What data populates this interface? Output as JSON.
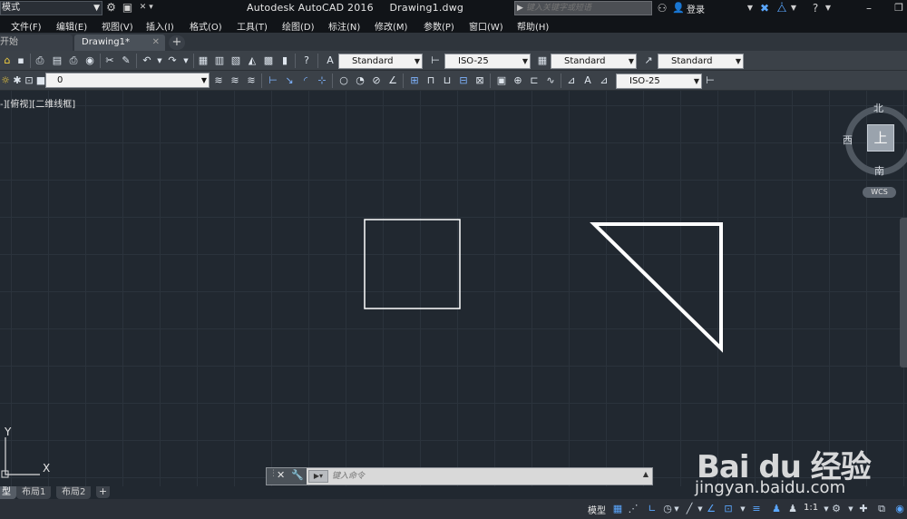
{
  "title_bar": {
    "workspace": "模式",
    "app_name": "Autodesk AutoCAD 2016",
    "file_name": "Drawing1.dwg",
    "search_placeholder": "键入关键字或短语",
    "login_label": "登录"
  },
  "menu": {
    "items": [
      "文件(F)",
      "编辑(E)",
      "视图(V)",
      "插入(I)",
      "格式(O)",
      "工具(T)",
      "绘图(D)",
      "标注(N)",
      "修改(M)",
      "参数(P)",
      "窗口(W)",
      "帮助(H)"
    ]
  },
  "tabs": {
    "items": [
      {
        "label": "开始"
      },
      {
        "label": "Drawing1*"
      }
    ],
    "add_label": "+"
  },
  "toolbar": {
    "text_style": "Standard",
    "dim_style": "ISO-25",
    "table_style": "Standard",
    "multileader_style": "Standard",
    "layer": "0",
    "dim_style_2": "ISO-25"
  },
  "viewport": {
    "label": "-][俯视][二维线框]"
  },
  "viewcube": {
    "north": "北",
    "south": "南",
    "west": "西",
    "face": "上",
    "wcs": "WCS"
  },
  "ucs": {
    "y": "Y",
    "x": "X"
  },
  "command_line": {
    "placeholder": "键入命令"
  },
  "layout_tabs": {
    "items": [
      "型",
      "布局1",
      "布局2"
    ],
    "add_label": "+"
  },
  "status_bar": {
    "model": "模型",
    "scale": "1:1"
  },
  "watermark": {
    "logo": "Bai du 经验",
    "url": "jingyan.baidu.com"
  },
  "colors": {
    "canvas_bg": "#212830",
    "grid": "#2b333c",
    "geometry": "#ffffff"
  }
}
